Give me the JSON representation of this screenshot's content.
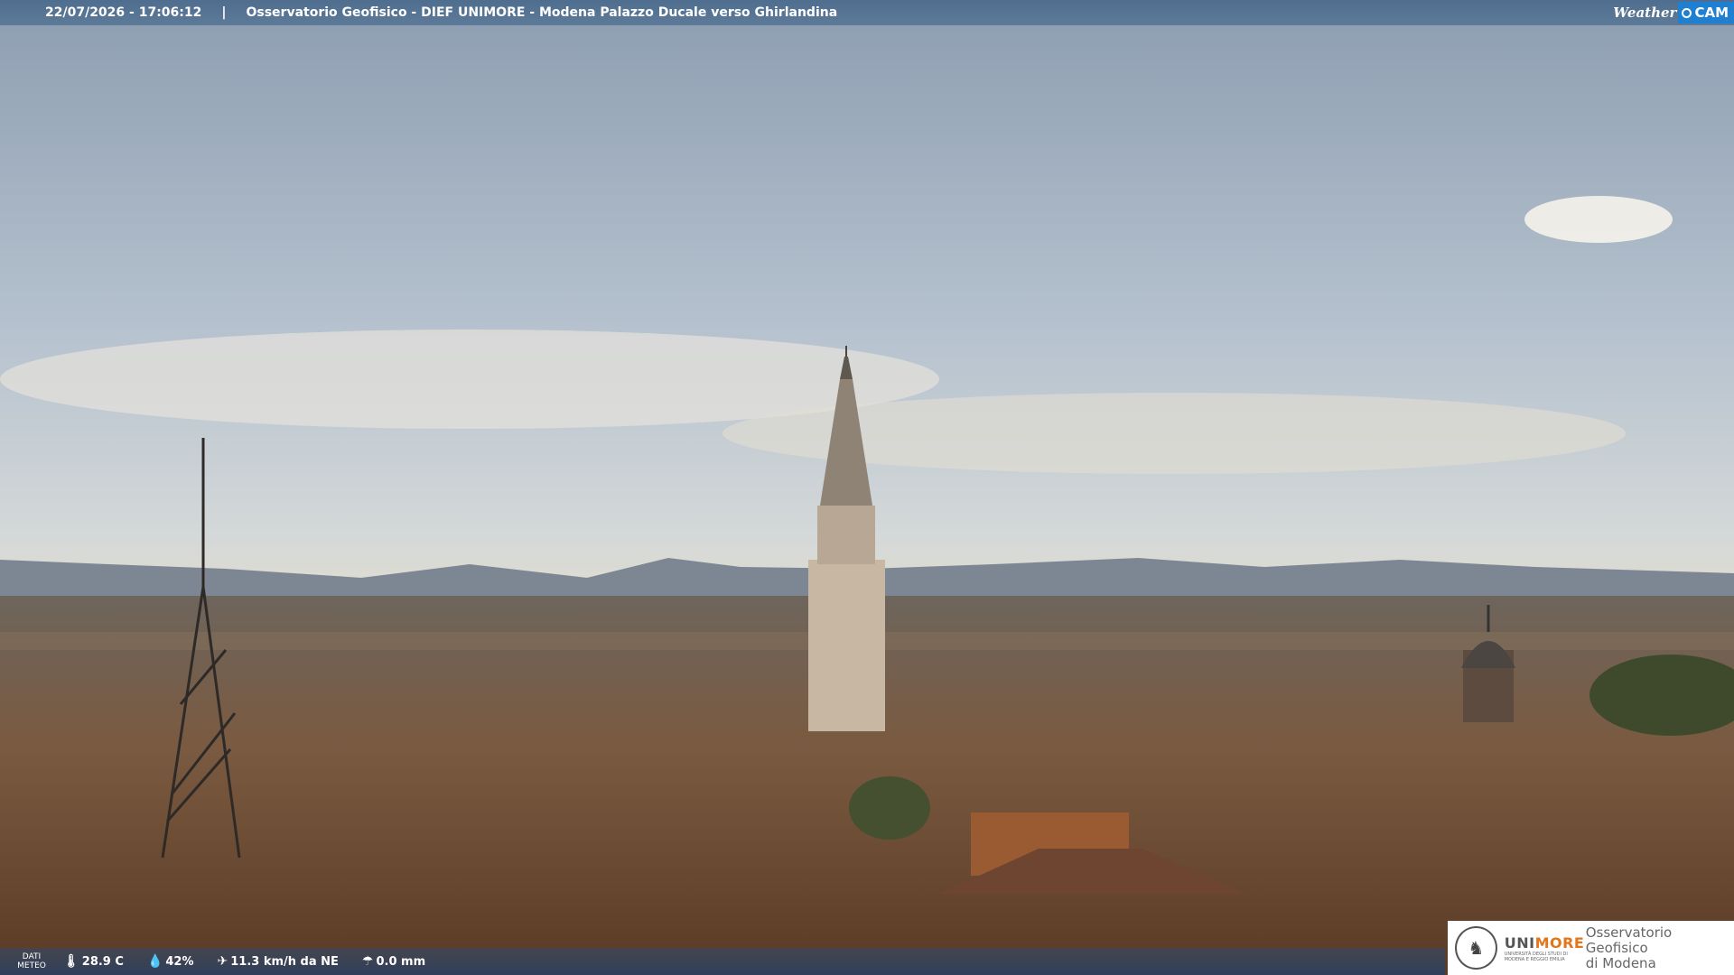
{
  "header": {
    "timestamp": "22/07/2026 - 17:06:12",
    "separator": "|",
    "title": "Osservatorio Geofisico - DIEF UNIMORE - Modena Palazzo Ducale verso Ghirlandina",
    "logo_weather": "Weather",
    "logo_cam": "CAM"
  },
  "footer": {
    "dati_line1": "DATI",
    "dati_line2": "METEO",
    "temperature": "28.9 C",
    "humidity": "42%",
    "wind": "11.3 km/h da NE",
    "rain": "0.0 mm"
  },
  "badge": {
    "uni_prefix": "UNI",
    "uni_suffix": "MORE",
    "uni_sub": "UNIVERSITÀ DEGLI STUDI DI MODENA E REGGIO EMILIA",
    "name_line1": "Osservatorio Geofisico",
    "name_line2": "di Modena"
  },
  "colors": {
    "top_bar": "#5a7797",
    "cam_blue": "#1f7fd0",
    "unimore_orange": "#e3761a"
  },
  "icons": [
    "thermometer-icon",
    "humidity-icon",
    "wind-icon",
    "rain-gauge-icon",
    "university-seal-icon"
  ]
}
